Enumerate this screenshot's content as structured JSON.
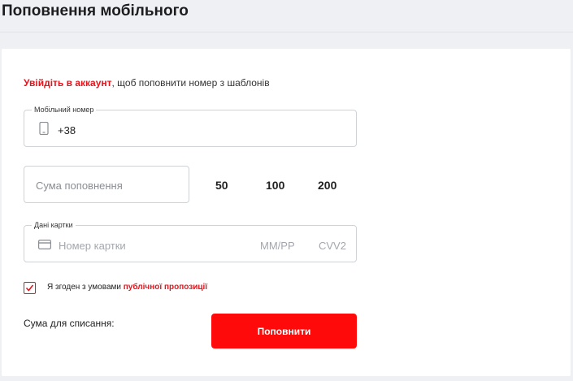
{
  "header": {
    "title": "Поповнення мобільного"
  },
  "login_prompt": {
    "link_text": "Увійдіть в аккаунт",
    "rest_text": ", щоб поповнити номер з шаблонів"
  },
  "phone": {
    "legend": "Мобільний номер",
    "prefix": "+38",
    "icon": "mobile-phone-icon"
  },
  "amount": {
    "placeholder": "Сума поповнення",
    "presets": [
      "50",
      "100",
      "200"
    ]
  },
  "card": {
    "legend": "Дані картки",
    "number_placeholder": "Номер картки",
    "expiry_placeholder": "ММ/РР",
    "cvv_placeholder": "CVV2",
    "icon": "credit-card-icon"
  },
  "agreement": {
    "checked": true,
    "text": "Я згоден з умовами ",
    "link_text": "публічної пропозиції"
  },
  "summary": {
    "charge_label": "Сума для списання:"
  },
  "submit": {
    "label": "Поповнити"
  },
  "colors": {
    "accent": "#e3141c",
    "button": "#ff0a0a",
    "background": "#eef0f3"
  }
}
